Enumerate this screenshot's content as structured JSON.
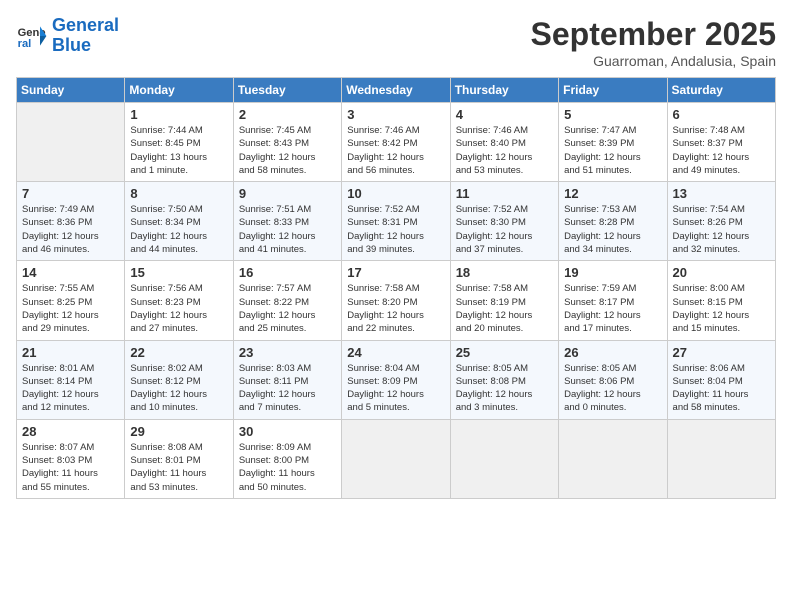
{
  "header": {
    "logo_line1": "General",
    "logo_line2": "Blue",
    "month": "September 2025",
    "location": "Guarroman, Andalusia, Spain"
  },
  "weekdays": [
    "Sunday",
    "Monday",
    "Tuesday",
    "Wednesday",
    "Thursday",
    "Friday",
    "Saturday"
  ],
  "weeks": [
    [
      {
        "day": "",
        "info": ""
      },
      {
        "day": "1",
        "info": "Sunrise: 7:44 AM\nSunset: 8:45 PM\nDaylight: 13 hours\nand 1 minute."
      },
      {
        "day": "2",
        "info": "Sunrise: 7:45 AM\nSunset: 8:43 PM\nDaylight: 12 hours\nand 58 minutes."
      },
      {
        "day": "3",
        "info": "Sunrise: 7:46 AM\nSunset: 8:42 PM\nDaylight: 12 hours\nand 56 minutes."
      },
      {
        "day": "4",
        "info": "Sunrise: 7:46 AM\nSunset: 8:40 PM\nDaylight: 12 hours\nand 53 minutes."
      },
      {
        "day": "5",
        "info": "Sunrise: 7:47 AM\nSunset: 8:39 PM\nDaylight: 12 hours\nand 51 minutes."
      },
      {
        "day": "6",
        "info": "Sunrise: 7:48 AM\nSunset: 8:37 PM\nDaylight: 12 hours\nand 49 minutes."
      }
    ],
    [
      {
        "day": "7",
        "info": "Sunrise: 7:49 AM\nSunset: 8:36 PM\nDaylight: 12 hours\nand 46 minutes."
      },
      {
        "day": "8",
        "info": "Sunrise: 7:50 AM\nSunset: 8:34 PM\nDaylight: 12 hours\nand 44 minutes."
      },
      {
        "day": "9",
        "info": "Sunrise: 7:51 AM\nSunset: 8:33 PM\nDaylight: 12 hours\nand 41 minutes."
      },
      {
        "day": "10",
        "info": "Sunrise: 7:52 AM\nSunset: 8:31 PM\nDaylight: 12 hours\nand 39 minutes."
      },
      {
        "day": "11",
        "info": "Sunrise: 7:52 AM\nSunset: 8:30 PM\nDaylight: 12 hours\nand 37 minutes."
      },
      {
        "day": "12",
        "info": "Sunrise: 7:53 AM\nSunset: 8:28 PM\nDaylight: 12 hours\nand 34 minutes."
      },
      {
        "day": "13",
        "info": "Sunrise: 7:54 AM\nSunset: 8:26 PM\nDaylight: 12 hours\nand 32 minutes."
      }
    ],
    [
      {
        "day": "14",
        "info": "Sunrise: 7:55 AM\nSunset: 8:25 PM\nDaylight: 12 hours\nand 29 minutes."
      },
      {
        "day": "15",
        "info": "Sunrise: 7:56 AM\nSunset: 8:23 PM\nDaylight: 12 hours\nand 27 minutes."
      },
      {
        "day": "16",
        "info": "Sunrise: 7:57 AM\nSunset: 8:22 PM\nDaylight: 12 hours\nand 25 minutes."
      },
      {
        "day": "17",
        "info": "Sunrise: 7:58 AM\nSunset: 8:20 PM\nDaylight: 12 hours\nand 22 minutes."
      },
      {
        "day": "18",
        "info": "Sunrise: 7:58 AM\nSunset: 8:19 PM\nDaylight: 12 hours\nand 20 minutes."
      },
      {
        "day": "19",
        "info": "Sunrise: 7:59 AM\nSunset: 8:17 PM\nDaylight: 12 hours\nand 17 minutes."
      },
      {
        "day": "20",
        "info": "Sunrise: 8:00 AM\nSunset: 8:15 PM\nDaylight: 12 hours\nand 15 minutes."
      }
    ],
    [
      {
        "day": "21",
        "info": "Sunrise: 8:01 AM\nSunset: 8:14 PM\nDaylight: 12 hours\nand 12 minutes."
      },
      {
        "day": "22",
        "info": "Sunrise: 8:02 AM\nSunset: 8:12 PM\nDaylight: 12 hours\nand 10 minutes."
      },
      {
        "day": "23",
        "info": "Sunrise: 8:03 AM\nSunset: 8:11 PM\nDaylight: 12 hours\nand 7 minutes."
      },
      {
        "day": "24",
        "info": "Sunrise: 8:04 AM\nSunset: 8:09 PM\nDaylight: 12 hours\nand 5 minutes."
      },
      {
        "day": "25",
        "info": "Sunrise: 8:05 AM\nSunset: 8:08 PM\nDaylight: 12 hours\nand 3 minutes."
      },
      {
        "day": "26",
        "info": "Sunrise: 8:05 AM\nSunset: 8:06 PM\nDaylight: 12 hours\nand 0 minutes."
      },
      {
        "day": "27",
        "info": "Sunrise: 8:06 AM\nSunset: 8:04 PM\nDaylight: 11 hours\nand 58 minutes."
      }
    ],
    [
      {
        "day": "28",
        "info": "Sunrise: 8:07 AM\nSunset: 8:03 PM\nDaylight: 11 hours\nand 55 minutes."
      },
      {
        "day": "29",
        "info": "Sunrise: 8:08 AM\nSunset: 8:01 PM\nDaylight: 11 hours\nand 53 minutes."
      },
      {
        "day": "30",
        "info": "Sunrise: 8:09 AM\nSunset: 8:00 PM\nDaylight: 11 hours\nand 50 minutes."
      },
      {
        "day": "",
        "info": ""
      },
      {
        "day": "",
        "info": ""
      },
      {
        "day": "",
        "info": ""
      },
      {
        "day": "",
        "info": ""
      }
    ]
  ]
}
